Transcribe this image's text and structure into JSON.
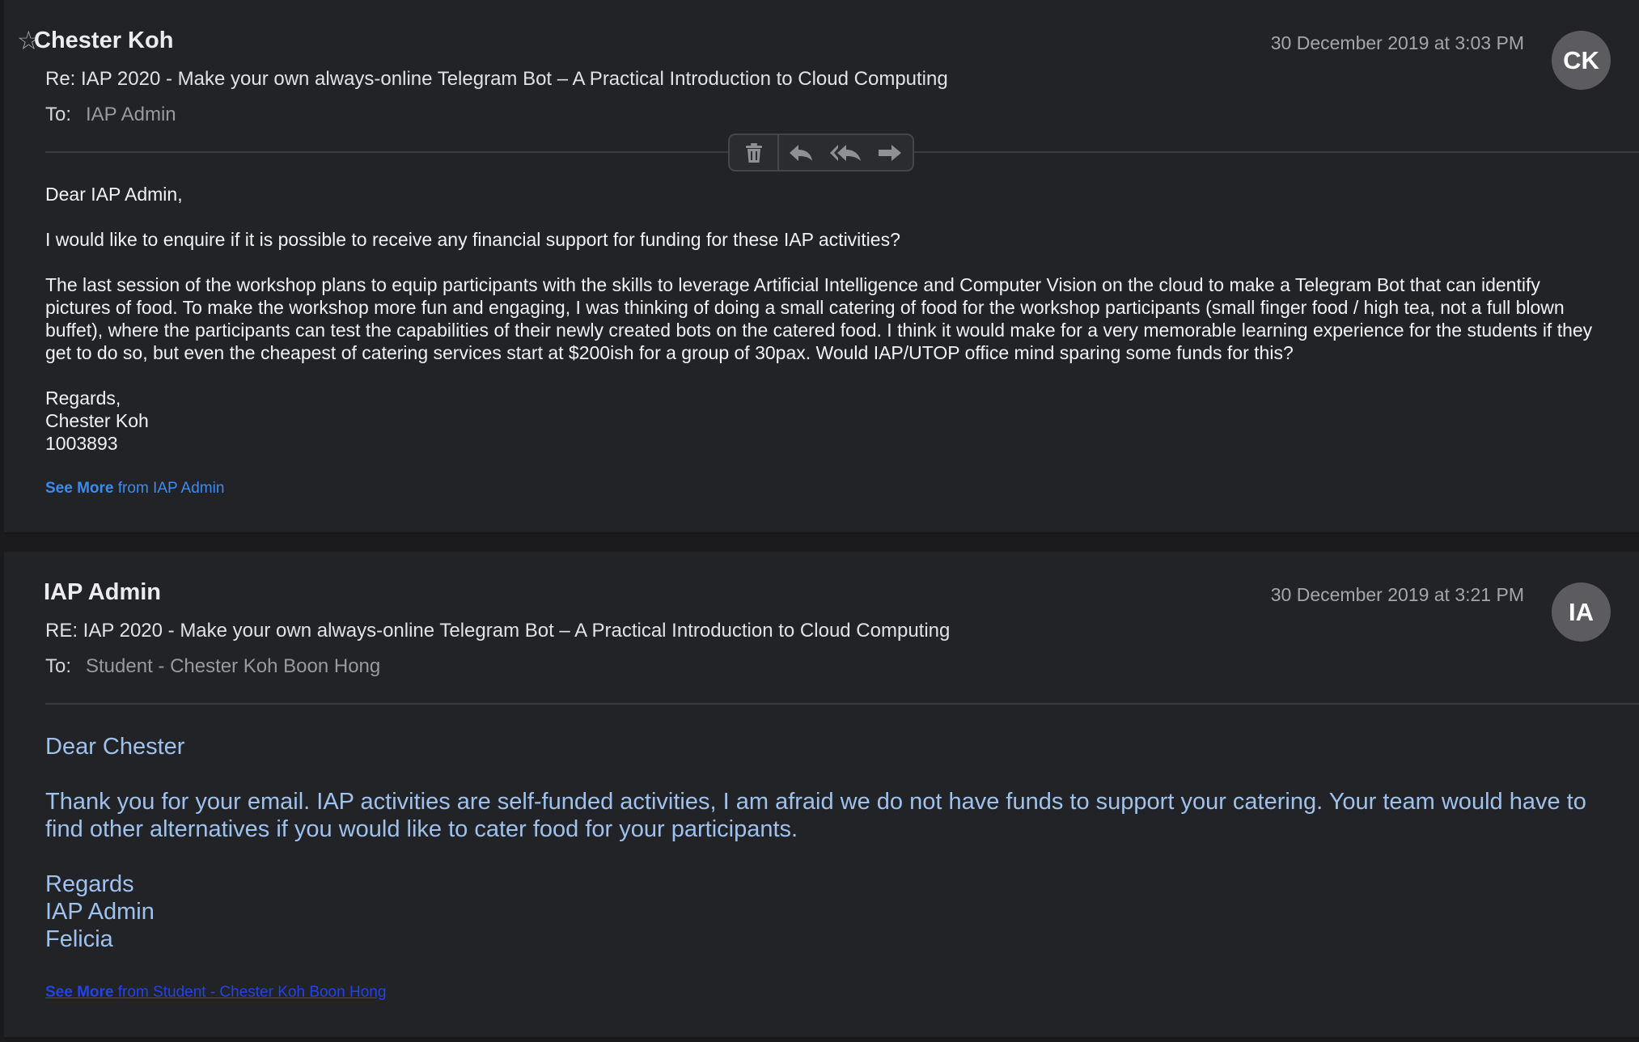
{
  "messages": [
    {
      "sender": "Chester Koh",
      "date": "30 December 2019 at 3:03 PM",
      "avatar_initials": "CK",
      "subject": "Re: IAP 2020 - Make your own always-online Telegram Bot – A Practical Introduction to Cloud Computing",
      "to_label": "To:",
      "to_value": "IAP Admin",
      "body": [
        "Dear IAP Admin,",
        "I would like to enquire if it is possible to receive any financial support for funding for these IAP activities?",
        "The last session of the workshop plans to equip participants with the skills to leverage Artificial Intelligence and Computer Vision on the cloud to make a Telegram Bot that can identify pictures of food. To make the workshop more fun and engaging, I was thinking of doing a small catering of food for the workshop participants (small finger food / high tea, not a full blown buffet), where the participants can test the capabilities of their newly created bots on the catered food. I think it would make for a very memorable learning experience for the students if they get to do so, but even the cheapest of catering services start at $200ish for a group of 30pax. Would IAP/UTOP office mind sparing some funds for this?",
        "Regards,",
        "Chester Koh",
        "1003893"
      ],
      "see_more": "See More",
      "see_more_from": "from IAP Admin"
    },
    {
      "sender": "IAP Admin",
      "date": "30 December 2019 at 3:21 PM",
      "avatar_initials": "IA",
      "subject": "RE: IAP 2020 - Make your own always-online Telegram Bot – A Practical Introduction to Cloud Computing",
      "to_label": "To:",
      "to_value": "Student - Chester Koh Boon Hong",
      "body": [
        "Dear Chester",
        "Thank you for your email. IAP activities are self-funded activities, I am afraid we do not have funds to support your catering. Your team would have to find other alternatives if you would like to cater food for your participants.",
        "Regards",
        "IAP Admin",
        "Felicia"
      ],
      "see_more": "See More",
      "see_more_from": "from Student - Chester Koh Boon Hong"
    }
  ],
  "toolbar": {
    "icons": [
      "trash-icon",
      "reply-icon",
      "reply-all-icon",
      "forward-icon"
    ]
  },
  "colors": {
    "background": "#222326",
    "body_text": "#f2f2f4",
    "reply_text": "#9ec1ed",
    "link": "#3b8cf0",
    "visited_link": "#2243e8"
  }
}
